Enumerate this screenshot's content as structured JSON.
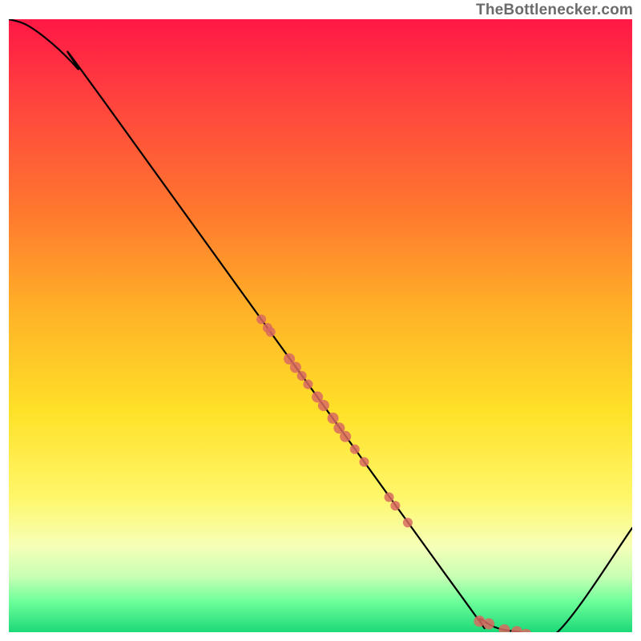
{
  "watermark": "TheBottlenecker.com",
  "chart_data": {
    "type": "line",
    "title": "",
    "xlabel": "",
    "ylabel": "",
    "xlim": [
      0,
      100
    ],
    "ylim": [
      0,
      100
    ],
    "grid": false,
    "legend": false,
    "background_gradient": {
      "direction": "vertical",
      "stops": [
        {
          "pos": 0.0,
          "color": "#ff1745"
        },
        {
          "pos": 0.12,
          "color": "#ff3f3f"
        },
        {
          "pos": 0.32,
          "color": "#ff7a2e"
        },
        {
          "pos": 0.48,
          "color": "#ffb327"
        },
        {
          "pos": 0.64,
          "color": "#ffe128"
        },
        {
          "pos": 0.78,
          "color": "#fff76a"
        },
        {
          "pos": 0.86,
          "color": "#f6ffb8"
        },
        {
          "pos": 0.91,
          "color": "#c6ffb3"
        },
        {
          "pos": 0.95,
          "color": "#6dff9a"
        },
        {
          "pos": 1.0,
          "color": "#1dd978"
        }
      ]
    },
    "series": [
      {
        "name": "bottleneck-curve",
        "x": [
          0.0,
          3.0,
          7.0,
          11.0,
          15.0,
          70.0,
          76.0,
          82.0,
          88.0,
          100.0
        ],
        "y": [
          100.0,
          99.0,
          96.0,
          92.0,
          87.0,
          9.5,
          2.0,
          0.0,
          0.0,
          17.0
        ],
        "smoothing": "monotone"
      }
    ],
    "scatter": {
      "name": "marker-cluster",
      "color": "#d96a60",
      "opacity": 0.85,
      "points_on_curve": true,
      "x": [
        40.5,
        41.5,
        42.0,
        45.0,
        46.0,
        47.0,
        48.0,
        49.5,
        50.5,
        52.0,
        53.0,
        54.0,
        55.5,
        57.0,
        61.0,
        62.0,
        64.0,
        75.5,
        77.0,
        79.5,
        81.5,
        83.0
      ],
      "radius": [
        6,
        6,
        6,
        7,
        7,
        6,
        6,
        7,
        7,
        7,
        7,
        7,
        6,
        6,
        6,
        6,
        6,
        7,
        7,
        7,
        7,
        7
      ]
    }
  }
}
